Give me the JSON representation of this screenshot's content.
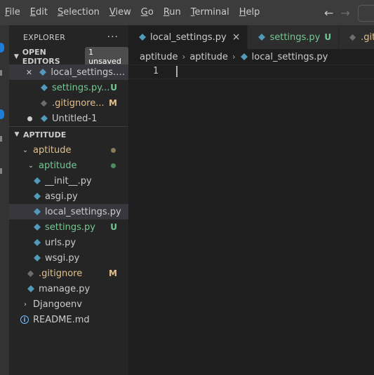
{
  "menu": {
    "items": [
      {
        "mnemonic": "F",
        "rest": "ile"
      },
      {
        "mnemonic": "E",
        "rest": "dit"
      },
      {
        "mnemonic": "S",
        "rest": "election"
      },
      {
        "mnemonic": "V",
        "rest": "iew"
      },
      {
        "mnemonic": "G",
        "rest": "o"
      },
      {
        "mnemonic": "R",
        "rest": "un"
      },
      {
        "mnemonic": "T",
        "rest": "erminal"
      },
      {
        "mnemonic": "H",
        "rest": "elp"
      }
    ],
    "back_icon": "arrow-left-icon",
    "forward_icon": "arrow-right-icon"
  },
  "sidebar": {
    "title": "EXPLORER",
    "more": "···",
    "open_editors": {
      "label": "OPEN EDITORS",
      "badge": "1 unsaved",
      "items": [
        {
          "name": "local_settings.py...",
          "lead": "close-icon",
          "icon": "python-icon"
        },
        {
          "name": "settings.py...",
          "status": "U",
          "icon": "python-icon"
        },
        {
          "name": ".gitignore...",
          "status": "M",
          "icon": "git-icon"
        },
        {
          "name": "Untitled-1",
          "lead": "dirty-dot-icon",
          "icon": "python-icon"
        }
      ]
    },
    "workspace": {
      "label": "APTITUDE",
      "tree": [
        {
          "name": "aptitude",
          "type": "folder",
          "expanded": true
        },
        {
          "name": "aptitude",
          "type": "folder",
          "expanded": true
        },
        {
          "name": "__init__.py",
          "type": "file"
        },
        {
          "name": "asgi.py",
          "type": "file"
        },
        {
          "name": "local_settings.py",
          "type": "file"
        },
        {
          "name": "settings.py",
          "type": "file",
          "status": "U"
        },
        {
          "name": "urls.py",
          "type": "file"
        },
        {
          "name": "wsgi.py",
          "type": "file"
        },
        {
          "name": ".gitignore",
          "type": "git",
          "status": "M"
        },
        {
          "name": "manage.py",
          "type": "file"
        },
        {
          "name": "Djangoenv",
          "type": "folder",
          "expanded": false
        },
        {
          "name": "README.md",
          "type": "info"
        }
      ]
    }
  },
  "editor": {
    "tabs": [
      {
        "label": "local_settings.py",
        "close": "×"
      },
      {
        "label": "settings.py",
        "status": "U"
      },
      {
        "label": ".gitig"
      }
    ],
    "breadcrumb": [
      "aptitude",
      "aptitude",
      "local_settings.py"
    ],
    "line_number": "1"
  },
  "colors": {
    "modified": "#e2c08d",
    "untracked": "#73c991",
    "python_blue": "#519aba",
    "git_dot": "#6d6d6d"
  }
}
